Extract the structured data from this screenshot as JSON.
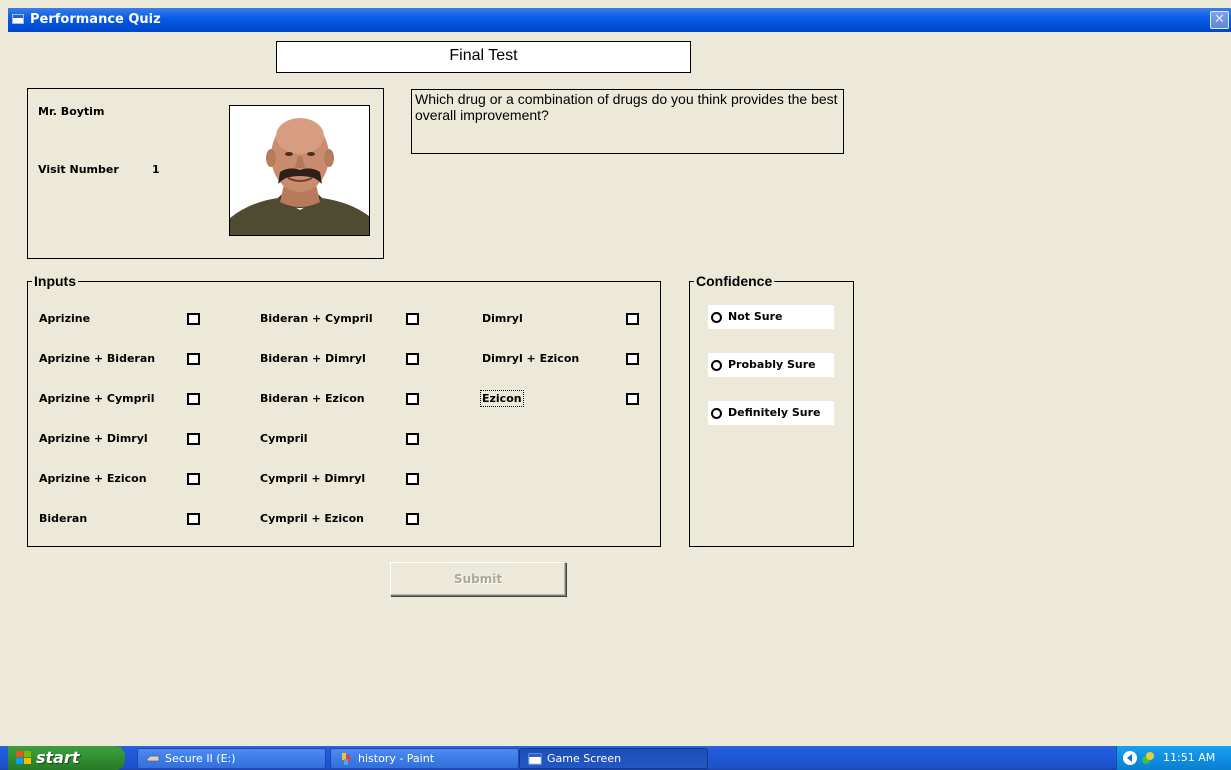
{
  "window": {
    "title": "Performance Quiz",
    "close_glyph": "✕"
  },
  "header": {
    "test_title": "Final Test"
  },
  "patient": {
    "name": "Mr. Boytim",
    "visit_label": "Visit Number",
    "visit_number": "1",
    "photo_icon": "patient-photo"
  },
  "question": {
    "text": "Which drug or a combination of drugs do you think provides the best overall improvement?"
  },
  "inputs": {
    "legend": "Inputs",
    "columns": [
      [
        {
          "label": "Aprizine",
          "checked": false
        },
        {
          "label": "Aprizine + Bideran",
          "checked": false
        },
        {
          "label": "Aprizine + Cympril",
          "checked": false
        },
        {
          "label": "Aprizine + Dimryl",
          "checked": false
        },
        {
          "label": "Aprizine + Ezicon",
          "checked": false
        },
        {
          "label": "Bideran",
          "checked": false
        }
      ],
      [
        {
          "label": "Bideran + Cympril",
          "checked": false
        },
        {
          "label": "Bideran + Dimryl",
          "checked": false
        },
        {
          "label": "Bideran + Ezicon",
          "checked": false
        },
        {
          "label": "Cympril",
          "checked": false
        },
        {
          "label": "Cympril + Dimryl",
          "checked": false
        },
        {
          "label": "Cympril + Ezicon",
          "checked": false
        }
      ],
      [
        {
          "label": "Dimryl",
          "checked": false
        },
        {
          "label": "Dimryl + Ezicon",
          "checked": false
        },
        {
          "label": "Ezicon",
          "checked": false,
          "focused": true
        }
      ]
    ]
  },
  "confidence": {
    "legend": "Confidence",
    "options": [
      {
        "label": "Not Sure",
        "selected": false
      },
      {
        "label": "Probably Sure",
        "selected": false
      },
      {
        "label": "Definitely Sure",
        "selected": false
      }
    ]
  },
  "actions": {
    "submit_label": "Submit",
    "submit_enabled": false
  },
  "taskbar": {
    "start_label": "start",
    "tasks": [
      {
        "label": "Secure II (E:)",
        "icon": "drive-icon"
      },
      {
        "label": "history - Paint",
        "icon": "paint-icon"
      },
      {
        "label": "Game Screen",
        "icon": "window-icon"
      }
    ],
    "clock": "11:51 AM"
  },
  "colors": {
    "window_bg": "#ece9d8",
    "titlebar": "#0a5ee6",
    "taskbar": "#245edb",
    "start_button": "#3a9a3a",
    "tray": "#0f8fe4"
  }
}
